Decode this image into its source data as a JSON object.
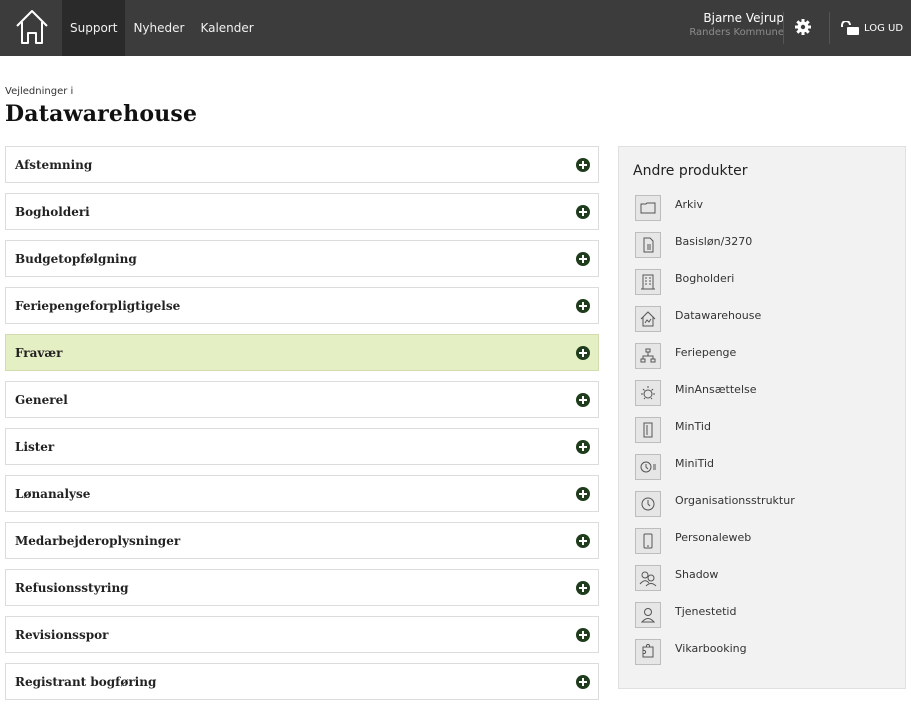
{
  "topbar": {
    "nav": [
      {
        "label": "Support",
        "active": true
      },
      {
        "label": "Nyheder",
        "active": false
      },
      {
        "label": "Kalender",
        "active": false
      }
    ],
    "user": {
      "name": "Bjarne Vejrup",
      "org": "Randers Kommune"
    },
    "logout_label": "LOG UD",
    "icons": {
      "home": "house-icon",
      "settings": "gear-icon",
      "logout": "unlock-icon"
    }
  },
  "heading": {
    "subtitle": "Vejledninger i",
    "title": "Datawarehouse"
  },
  "accordion": {
    "items": [
      {
        "label": "Afstemning"
      },
      {
        "label": "Bogholderi"
      },
      {
        "label": "Budgetopfølgning"
      },
      {
        "label": "Feriepengeforpligtigelse"
      },
      {
        "label": "Fravær",
        "highlighted": true
      },
      {
        "label": "Generel"
      },
      {
        "label": "Lister"
      },
      {
        "label": "Lønanalyse"
      },
      {
        "label": "Medarbejderoplysninger"
      },
      {
        "label": "Refusionsstyring"
      },
      {
        "label": "Revisionsspor"
      },
      {
        "label": "Registrant bogføring"
      }
    ],
    "highlight_color": "#e5efc4",
    "expand_icon": "plus-circle-icon",
    "expand_icon_color": "#1f3d1c"
  },
  "panel": {
    "title": "Andre produkter",
    "products": [
      {
        "label": "Arkiv",
        "icon": "folder-icon"
      },
      {
        "label": "Basisløn/3270",
        "icon": "coins-document-icon"
      },
      {
        "label": "Bogholderi",
        "icon": "building-icon"
      },
      {
        "label": "Datawarehouse",
        "icon": "house-chart-icon"
      },
      {
        "label": "Feriepenge",
        "icon": "org-chart-icon"
      },
      {
        "label": "MinAnsættelse",
        "icon": "sun-icon"
      },
      {
        "label": "MinTid",
        "icon": "door-icon"
      },
      {
        "label": "MiniTid",
        "icon": "clock-list-icon"
      },
      {
        "label": "Organisationsstruktur",
        "icon": "clock-icon"
      },
      {
        "label": "Personaleweb",
        "icon": "phone-icon"
      },
      {
        "label": "Shadow",
        "icon": "people-icon"
      },
      {
        "label": "Tjenestetid",
        "icon": "person-clock-icon"
      },
      {
        "label": "Vikarbooking",
        "icon": "puzzle-icon"
      }
    ]
  }
}
